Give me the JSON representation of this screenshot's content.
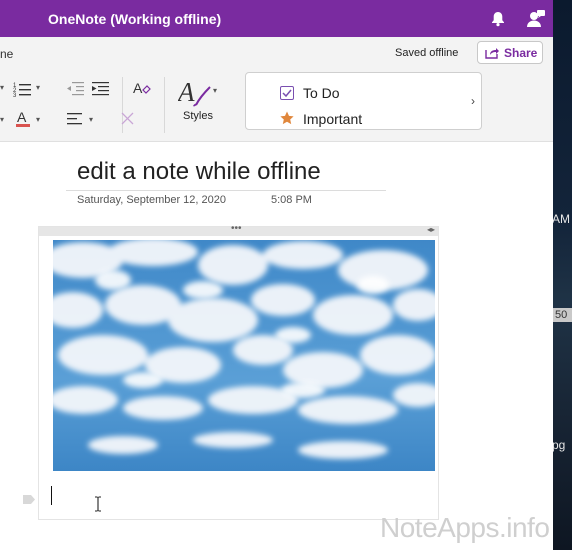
{
  "window": {
    "title": "OneNote (Working offline)",
    "accent_color": "#7a2ba0"
  },
  "status": {
    "tab_fragment": "ne",
    "saved_text": "Saved offline",
    "share_label": "Share"
  },
  "ribbon": {
    "styles_label": "Styles",
    "tags": [
      {
        "label": "To Do",
        "icon": "checkbox-icon"
      },
      {
        "label": "Important",
        "icon": "star-icon"
      }
    ]
  },
  "page": {
    "title": "edit a note while offline",
    "date": "Saturday, September 12, 2020",
    "time": "5:08 PM",
    "image_description_icon": "sky-clouds-image"
  },
  "desktop": {
    "fragments": [
      "AM",
      "50",
      "pg"
    ]
  },
  "watermark": "NoteApps.info"
}
